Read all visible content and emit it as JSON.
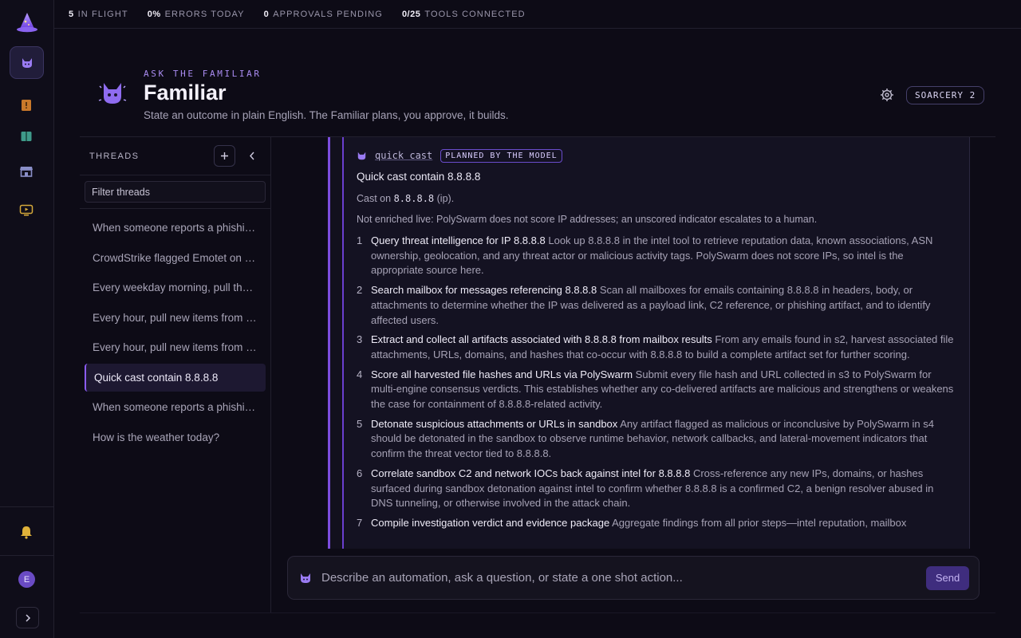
{
  "status_bar": [
    {
      "value": "5",
      "label": "IN FLIGHT"
    },
    {
      "value": "0%",
      "label": "ERRORS TODAY"
    },
    {
      "value": "0",
      "label": "APPROVALS PENDING"
    },
    {
      "value": "0/25",
      "label": "TOOLS CONNECTED"
    }
  ],
  "rail": {
    "icons": [
      "wizard-hat-logo-icon",
      "familiar-cat-icon",
      "playbook-icon",
      "book-icon",
      "store-icon",
      "monitor-icon",
      "bell-icon"
    ],
    "avatar_initial": "E",
    "accent": "#8b5cf6"
  },
  "header": {
    "eyebrow": "ASK THE FAMILIAR",
    "title": "Familiar",
    "subtitle": "State an outcome in plain English. The Familiar plans, you approve, it builds.",
    "model_badge": "SOARCERY 2"
  },
  "threads": {
    "title": "THREADS",
    "filter_placeholder": "Filter threads",
    "items": [
      {
        "label": "When someone reports a phishing email, investigate and triage it",
        "active": false
      },
      {
        "label": "CrowdStrike flagged Emotet on a host, contain it",
        "active": false
      },
      {
        "label": "Every weekday morning, pull the overnight alerts",
        "active": false
      },
      {
        "label": "Every hour, pull new items from the intel feed",
        "active": false
      },
      {
        "label": "Every hour, pull new items from the threat queue",
        "active": false
      },
      {
        "label": "Quick cast contain 8.8.8.8",
        "active": true
      },
      {
        "label": "When someone reports a phishing email, triage it",
        "active": false
      },
      {
        "label": "How is the weather today?",
        "active": false
      }
    ]
  },
  "plan": {
    "link": "quick cast",
    "badge": "PLANNED BY THE MODEL",
    "title": "Quick cast contain 8.8.8.8",
    "cast_prefix": "Cast on",
    "cast_target": "8.8.8.8",
    "cast_type": "(ip).",
    "note": "Not enriched live: PolySwarm does not score IP addresses; an unscored indicator escalates to a human.",
    "steps": [
      {
        "n": "1",
        "head": "Query threat intelligence for IP 8.8.8.8",
        "desc": "Look up 8.8.8.8 in the intel tool to retrieve reputation data, known associations, ASN ownership, geolocation, and any threat actor or malicious activity tags. PolySwarm does not score IPs, so intel is the appropriate source here."
      },
      {
        "n": "2",
        "head": "Search mailbox for messages referencing 8.8.8.8",
        "desc": "Scan all mailboxes for emails containing 8.8.8.8 in headers, body, or attachments to determine whether the IP was delivered as a payload link, C2 reference, or phishing artifact, and to identify affected users."
      },
      {
        "n": "3",
        "head": "Extract and collect all artifacts associated with 8.8.8.8 from mailbox results",
        "desc": "From any emails found in s2, harvest associated file attachments, URLs, domains, and hashes that co-occur with 8.8.8.8 to build a complete artifact set for further scoring."
      },
      {
        "n": "4",
        "head": "Score all harvested file hashes and URLs via PolySwarm",
        "desc": "Submit every file hash and URL collected in s3 to PolySwarm for multi-engine consensus verdicts. This establishes whether any co-delivered artifacts are malicious and strengthens or weakens the case for containment of 8.8.8.8-related activity."
      },
      {
        "n": "5",
        "head": "Detonate suspicious attachments or URLs in sandbox",
        "desc": "Any artifact flagged as malicious or inconclusive by PolySwarm in s4 should be detonated in the sandbox to observe runtime behavior, network callbacks, and lateral-movement indicators that confirm the threat vector tied to 8.8.8.8."
      },
      {
        "n": "6",
        "head": "Correlate sandbox C2 and network IOCs back against intel for 8.8.8.8",
        "desc": "Cross-reference any new IPs, domains, or hashes surfaced during sandbox detonation against intel to confirm whether 8.8.8.8 is a confirmed C2, a benign resolver abused in DNS tunneling, or otherwise involved in the attack chain."
      },
      {
        "n": "7",
        "head": "Compile investigation verdict and evidence package",
        "desc": "Aggregate findings from all prior steps—intel reputation, mailbox"
      }
    ]
  },
  "composer": {
    "placeholder": "Describe an automation, ask a question, or state a one shot action...",
    "send_label": "Send"
  }
}
